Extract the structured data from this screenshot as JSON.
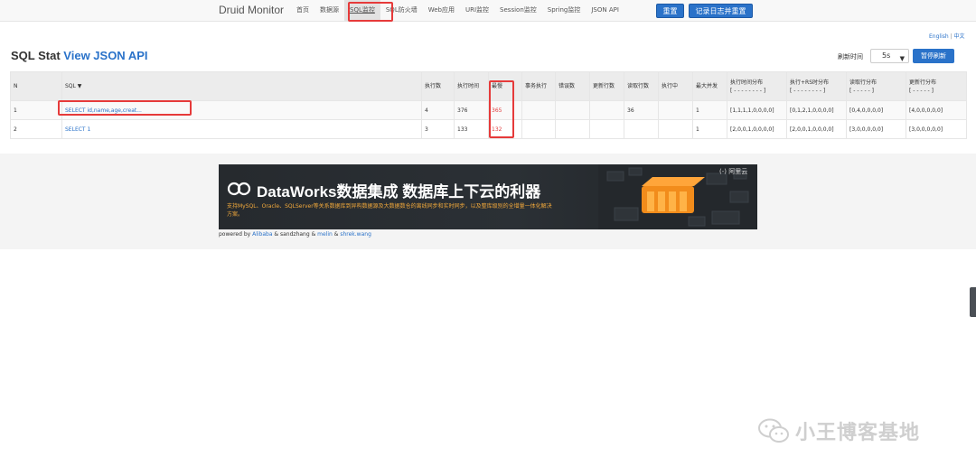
{
  "navbar": {
    "brand": "Druid Monitor",
    "items": [
      {
        "label": "首页"
      },
      {
        "label": "数据源"
      },
      {
        "label": "SQL监控"
      },
      {
        "label": "SQL防火墙"
      },
      {
        "label": "Web应用"
      },
      {
        "label": "URI监控"
      },
      {
        "label": "Session监控"
      },
      {
        "label": "Spring监控"
      },
      {
        "label": "JSON API"
      }
    ],
    "active": "SQL监控",
    "reset_button": "重置",
    "log_reset_button": "记录日志并重置"
  },
  "lang": {
    "english": "English",
    "separator": "|",
    "chinese": "中文"
  },
  "page": {
    "title": "SQL Stat",
    "json_link": "View JSON API",
    "refresh_label": "刷新时间",
    "refresh_value": "5s",
    "pause_button": "暂停刷新"
  },
  "table": {
    "headers": {
      "n": "N",
      "sql": "SQL ▼",
      "exec_count": "执行数",
      "exec_time": "执行时间",
      "slowest": "最慢",
      "txn_exec": "事务执行",
      "error_count": "错误数",
      "update_rows": "更新行数",
      "read_rows": "读取行数",
      "running": "执行中",
      "max_concurrent": "最大并发",
      "exec_hist_title": "执行时间分布",
      "exec_hist_sub": "[ - - - - - - - - ]",
      "rs_hist_title": "执行+RS时分布",
      "rs_hist_sub": "[ - - - - - - - - ]",
      "read_hist_title": "读取行分布",
      "read_hist_sub": "[ - - - - - ]",
      "update_hist_title": "更新行分布",
      "update_hist_sub": "[ - - - - - ]"
    },
    "rows": [
      {
        "n": "1",
        "sql": "SELECT id,name,age,creat...",
        "exec_count": "4",
        "exec_time": "376",
        "slowest": "365",
        "txn_exec": "",
        "error_count": "",
        "update_rows": "",
        "read_rows": "36",
        "running": "",
        "max_concurrent": "1",
        "exec_hist": "[1,1,1,1,0,0,0,0]",
        "rs_hist": "[0,1,2,1,0,0,0,0]",
        "read_hist": "[0,4,0,0,0,0]",
        "update_hist": "[4,0,0,0,0,0]"
      },
      {
        "n": "2",
        "sql": "SELECT 1",
        "exec_count": "3",
        "exec_time": "133",
        "slowest": "132",
        "txn_exec": "",
        "error_count": "",
        "update_rows": "",
        "read_rows": "",
        "running": "",
        "max_concurrent": "1",
        "exec_hist": "[2,0,0,1,0,0,0,0]",
        "rs_hist": "[2,0,0,1,0,0,0,0]",
        "read_hist": "[3,0,0,0,0,0]",
        "update_hist": "[3,0,0,0,0,0]"
      }
    ]
  },
  "banner": {
    "title": "DataWorks数据集成 数据库上下云的利器",
    "subtitle": "支持MySQL、Oracle、SQLServer等关系数据库到异构数据源及大数据数仓的离线同步和实时同步，以及整库级别的全增量一体化解决方案。",
    "brand": "阿里云",
    "brand_mark": "(-)"
  },
  "powered": {
    "prefix": "powered by ",
    "alibaba": "Alibaba",
    "amp1": " & sandzhang & ",
    "melin": "melin",
    "amp2": " & ",
    "shrek": "shrek.wang"
  },
  "watermark": {
    "text": "小王博客基地"
  },
  "colors": {
    "accent": "#2a72c9",
    "highlight": "#e63a3a",
    "slow": "#e13d3d",
    "banner_sub": "#f2a93b"
  }
}
